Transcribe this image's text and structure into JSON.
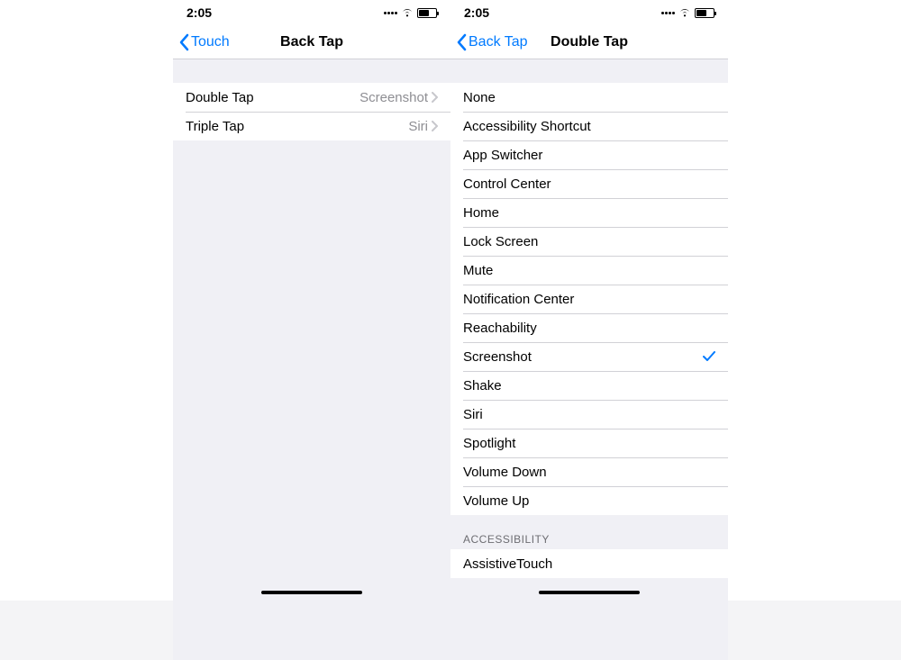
{
  "status": {
    "time": "2:05"
  },
  "left": {
    "nav": {
      "back_label": "Touch",
      "title": "Back Tap"
    },
    "rows": [
      {
        "label": "Double Tap",
        "value": "Screenshot"
      },
      {
        "label": "Triple Tap",
        "value": "Siri"
      }
    ]
  },
  "right": {
    "nav": {
      "back_label": "Back Tap",
      "title": "Double Tap"
    },
    "section1": {
      "options": [
        {
          "label": "None",
          "selected": false
        },
        {
          "label": "Accessibility Shortcut",
          "selected": false
        },
        {
          "label": "App Switcher",
          "selected": false
        },
        {
          "label": "Control Center",
          "selected": false
        },
        {
          "label": "Home",
          "selected": false
        },
        {
          "label": "Lock Screen",
          "selected": false
        },
        {
          "label": "Mute",
          "selected": false
        },
        {
          "label": "Notification Center",
          "selected": false
        },
        {
          "label": "Reachability",
          "selected": false
        },
        {
          "label": "Screenshot",
          "selected": true
        },
        {
          "label": "Shake",
          "selected": false
        },
        {
          "label": "Siri",
          "selected": false
        },
        {
          "label": "Spotlight",
          "selected": false
        },
        {
          "label": "Volume Down",
          "selected": false
        },
        {
          "label": "Volume Up",
          "selected": false
        }
      ]
    },
    "section2": {
      "header": "ACCESSIBILITY",
      "options": [
        {
          "label": "AssistiveTouch",
          "selected": false
        }
      ]
    }
  }
}
